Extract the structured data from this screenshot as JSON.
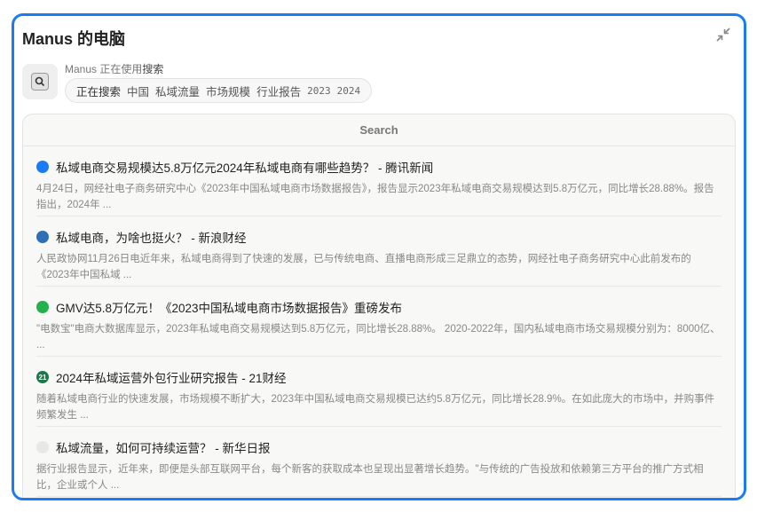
{
  "window": {
    "title": "Manus 的电脑"
  },
  "tool": {
    "icon": "search-icon",
    "prefix": "Manus 正在使用",
    "name": "搜索",
    "verb": "正在搜索",
    "keywords": [
      "中国",
      "私域流量",
      "市场规模",
      "行业报告"
    ],
    "years": [
      "2023",
      "2024"
    ]
  },
  "panel": {
    "title": "Search"
  },
  "results": [
    {
      "title": "私域电商交易规模达5.8万亿元2024年私域电商有哪些趋势？ - 腾讯新闻",
      "snippet": "4月24日，网经社电子商务研究中心《2023年中国私域电商市场数据报告》，报告显示2023年私域电商交易规模达到5.8万亿元，同比增长28.88%。报告指出，2024年 ...",
      "favicon_color": "#1a7cf5"
    },
    {
      "title": "私域电商，为啥也挺火？ - 新浪财经",
      "snippet": "人民政协网11月26日电近年来，私域电商得到了快速的发展，已与传统电商、直播电商形成三足鼎立的态势，网经社电子商务研究中心此前发布的《2023年中国私域 ...",
      "favicon_color": "#2f6fb8"
    },
    {
      "title": "GMV达5.8万亿元！《2023中国私域电商市场数据报告》重磅发布",
      "snippet": "\"电数宝\"电商大数据库显示，2023年私域电商交易规模达到5.8万亿元，同比增长28.88%。 2020-2022年，国内私域电商市场交易规模分别为：8000亿、 ...",
      "favicon_color": "#22b14c"
    },
    {
      "title": "2024年私域运营外包行业研究报告 - 21财经",
      "snippet": "随着私域电商行业的快速发展，市场规模不断扩大，2023年中国私域电商交易规模已达约5.8万亿元，同比增长28.9%。在如此庞大的市场中，并购事件频繁发生 ...",
      "favicon_color": "#1a7a4a",
      "favicon_text": "21"
    },
    {
      "title": "私域流量，如何可持续运营？ - 新华日报",
      "snippet": "据行业报告显示，近年来，即便是头部互联网平台，每个新客的获取成本也呈现出显著增长趋势。\"与传统的广告投放和依赖第三方平台的推广方式相比，企业或个人 ...",
      "favicon_color": "#e8e8e8"
    }
  ]
}
